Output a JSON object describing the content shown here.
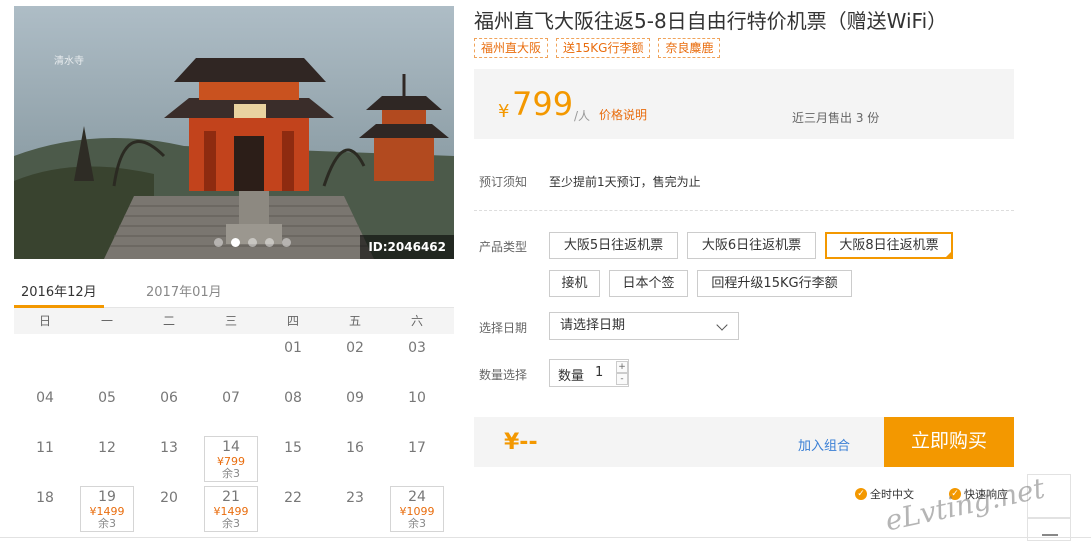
{
  "hero": {
    "id_badge": "ID:2046462",
    "slide_count": 5,
    "active_slide": 1
  },
  "calendar": {
    "tabs": [
      "2016年12月",
      "2017年01月"
    ],
    "weekdays": [
      "日",
      "一",
      "二",
      "三",
      "四",
      "五",
      "六"
    ],
    "days": [
      [
        null,
        null,
        null,
        null,
        {
          "d": "01"
        },
        {
          "d": "02"
        },
        {
          "d": "03"
        }
      ],
      [
        {
          "d": "04"
        },
        {
          "d": "05"
        },
        {
          "d": "06"
        },
        {
          "d": "07"
        },
        {
          "d": "08"
        },
        {
          "d": "09"
        },
        {
          "d": "10"
        }
      ],
      [
        {
          "d": "11"
        },
        {
          "d": "12"
        },
        {
          "d": "13"
        },
        {
          "d": "14",
          "price": "¥799",
          "left": "余3"
        },
        {
          "d": "15"
        },
        {
          "d": "16"
        },
        {
          "d": "17"
        }
      ],
      [
        {
          "d": "18"
        },
        {
          "d": "19",
          "price": "¥1499",
          "left": "余3"
        },
        {
          "d": "20"
        },
        {
          "d": "21",
          "price": "¥1499",
          "left": "余3"
        },
        {
          "d": "22"
        },
        {
          "d": "23"
        },
        {
          "d": "24",
          "price": "¥1099",
          "left": "余3"
        }
      ]
    ]
  },
  "product": {
    "title": "福州直飞大阪往返5-8日自由行特价机票（赠送WiFi）",
    "tags": [
      "福州直大阪",
      "送15KG行李额",
      "奈良麋鹿"
    ],
    "price": {
      "yen": "¥",
      "amount": "799",
      "unit": "/人",
      "link": "价格说明"
    },
    "sold": "近三月售出 3 份",
    "notice_label": "预订须知",
    "notice_text": "至少提前1天预订，售完为止",
    "type_label": "产品类型",
    "options": [
      {
        "label": "大阪5日往返机票",
        "selected": false
      },
      {
        "label": "大阪6日往返机票",
        "selected": false
      },
      {
        "label": "大阪8日往返机票",
        "selected": true
      },
      {
        "label": "接机",
        "selected": false
      },
      {
        "label": "日本个签",
        "selected": false
      },
      {
        "label": "回程升级15KG行李额",
        "selected": false
      }
    ],
    "date_label": "选择日期",
    "date_placeholder": "请选择日期",
    "qty_label": "数量选择",
    "qty_inner_label": "数量",
    "qty_value": "1",
    "qty_plus": "+",
    "qty_minus": "-",
    "total": "¥--",
    "add_combo": "加入组合",
    "buy": "立即购买",
    "features": [
      "全时中文",
      "快速响应"
    ]
  },
  "watermark": "eLvting.net",
  "colors": {
    "accent": "#f39800",
    "price_text": "#e96d0e",
    "link": "#3a7fd5"
  }
}
